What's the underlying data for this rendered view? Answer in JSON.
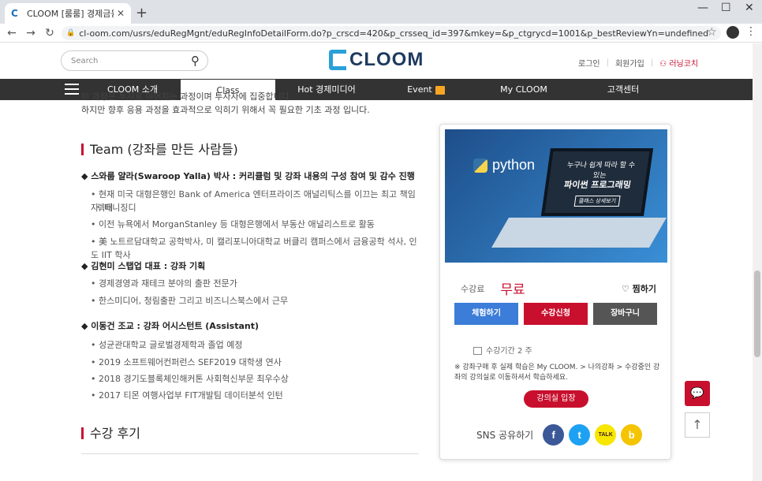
{
  "browser": {
    "tab_title": "CLOOM [룸룸] 경제금융 & 데이",
    "favicon": "C",
    "close": "✕",
    "new_tab": "+",
    "url": "cl-oom.com/usrs/eduRegMgnt/eduRegInfoDetailForm.do?p_crscd=420&p_crsseq_id=397&mkey=&p_ctgrycd=1001&p_bestReviewYn=undefined",
    "back": "←",
    "forward": "→",
    "reload": "↻",
    "star": "☆",
    "menu": "⋮",
    "win_min": "—",
    "win_max": "☐",
    "win_close": "✕"
  },
  "header": {
    "search_placeholder": "Search",
    "search_icon": "⚲",
    "logo_text": "CLOOM",
    "login": "로그인",
    "signup": "회원가입",
    "coach": "러닝코치"
  },
  "gnb": {
    "items": [
      "CLOOM 소개",
      "Class",
      "Hot 경제미디어",
      "Event",
      "My CLOOM",
      "고객센터"
    ]
  },
  "intro": {
    "line1": "이 과정은 투자로 이어지는 과정이며 투자자에 집중합니다.",
    "line2": "하지만 향후 응용 과정을 효과적으로 익히기 위해서 꼭 필요한 기초 과정 입니다."
  },
  "team": {
    "title": "Team (강좌를 만든 사람들)",
    "people": [
      {
        "name": "◆ 스와룹 얄라(Swaroop Yalla) 박사 : 커리큘럼 및 강좌 내용의 구성 참여 및 감수 진행",
        "bullets": [
          "• 현재 미국 대형은행인 Bank of America 엔터프라이즈 애널리틱스를 이끄는 최고 책임자, 매니징디",
          "렉터",
          "• 이전 뉴욕에서 MorganStanley 등 대형은행에서 부동산 애널리스트로 활동",
          "• 美 노트르담대학교 공학박사, 미 캘리포니아대학교 버클리 캠퍼스에서 금융공학 석사, 인도 IIT 학사"
        ]
      },
      {
        "name": "◆ 김현미 스탭업 대표 : 강좌 기획",
        "bullets": [
          "• 경제경영과 재테크 분야의 출판 전문가",
          "• 한스미디어, 청림출판 그리고 비즈니스북스에서 근무"
        ]
      },
      {
        "name": "◆ 이동건 조교 : 강좌 어시스턴트 (Assistant)",
        "bullets": [
          "• 성균관대학교 글로벌경제학과 졸업 예정",
          "• 2019 소프트웨어컨퍼런스 SEF2019 대학생 연사",
          "• 2018 경기도블록체인해커톤 사회혁신부문 최우수상",
          "• 2017 티몬 여행사업부 FIT개발팀 데이터분석 인턴"
        ]
      }
    ]
  },
  "review": {
    "title": "수강 후기"
  },
  "card": {
    "thumb_python": "python",
    "thumb_line1": "누구나 쉽게 따라 할 수 있는",
    "thumb_line2": "파이썬 프로그래밍",
    "thumb_badge": "클래스 상세보기",
    "price_label": "수강료",
    "price": "무료",
    "wish": "♡ 찜하기",
    "btn_trial": "체험하기",
    "btn_apply": "수강신청",
    "btn_cart": "장바구니",
    "period": "수강기간 2 주",
    "notice": "※ 강좌구매 후 실제 학습은 My CLOOM. > 나의강좌 > 수강중인 강좌의 강의실로 이동하셔서 학습하세요.",
    "enter": "강의실 입장",
    "sns_label": "SNS 공유하기",
    "sns": [
      "f",
      "t",
      "TALK",
      "b"
    ]
  },
  "float": {
    "chat": "💬",
    "top": "↑"
  },
  "colors": {
    "brand_red": "#c8102e",
    "trial_blue": "#3b7dd8",
    "cart_gray": "#555555",
    "facebook": "#3b5998",
    "twitter": "#1da1f2",
    "kakao": "#f7e600",
    "story": "#f5c400"
  }
}
